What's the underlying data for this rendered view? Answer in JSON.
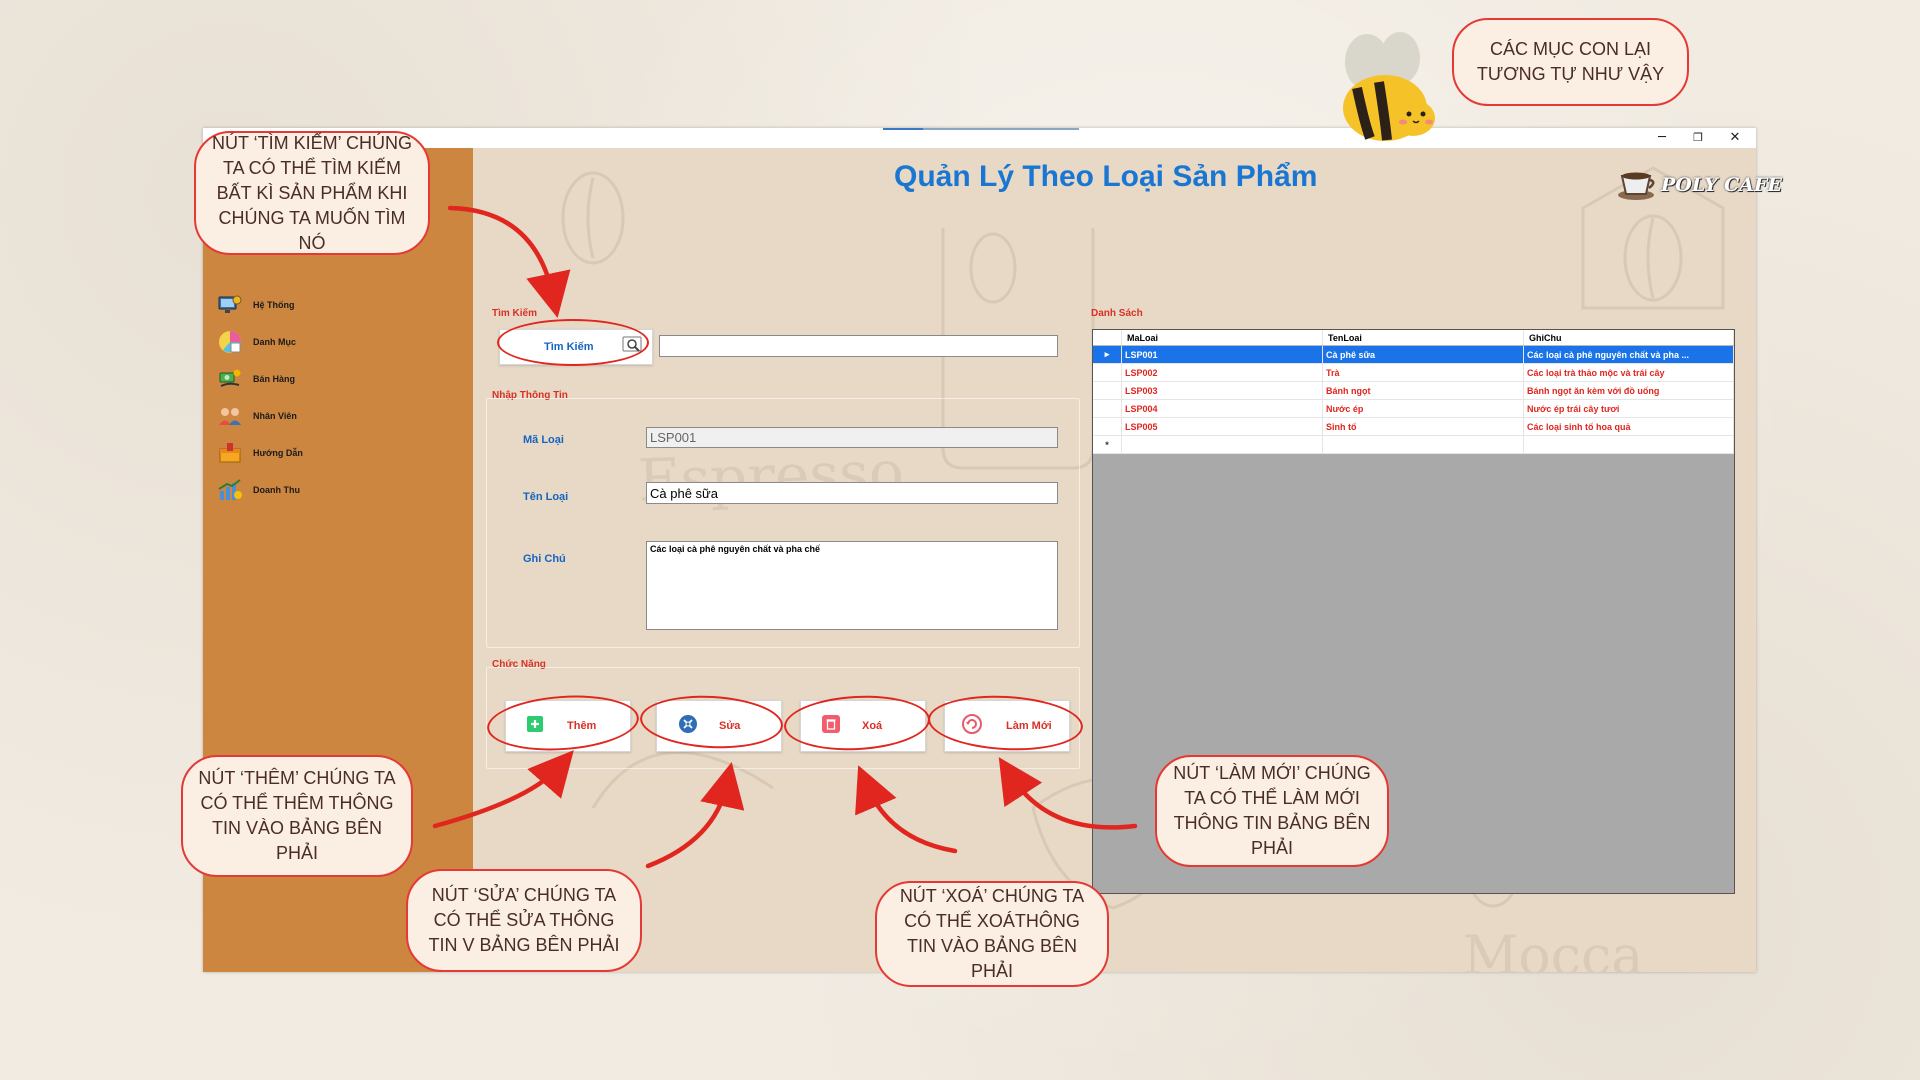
{
  "window": {
    "minimize_glyph": "─",
    "restore_glyph": "❐",
    "close_glyph": "✕"
  },
  "sidebar": {
    "items": [
      {
        "label": "Hệ Thống",
        "icon": "system-icon"
      },
      {
        "label": "Danh Mục",
        "icon": "category-icon"
      },
      {
        "label": "Bán Hàng",
        "icon": "sales-icon"
      },
      {
        "label": "Nhân Viên",
        "icon": "employee-icon"
      },
      {
        "label": "Hướng Dẫn",
        "icon": "guide-icon"
      },
      {
        "label": "Doanh Thu",
        "icon": "revenue-icon"
      }
    ]
  },
  "header": {
    "title": "Quản Lý Theo Loại Sản Phẩm",
    "logo_text": "POLY CAFE"
  },
  "search": {
    "group_title": "Tìm Kiếm",
    "button_label": "Tìm Kiếm",
    "value": ""
  },
  "form": {
    "group_title": "Nhập Thông Tin",
    "ma_loai_label": "Mã Loại",
    "ma_loai_value": "LSP001",
    "ten_loai_label": "Tên Loại",
    "ten_loai_value": "Cà phê sữa",
    "ghi_chu_label": "Ghi Chú",
    "ghi_chu_value": "Các loại cà phê nguyên chất và pha chế"
  },
  "actions": {
    "group_title": "Chức Năng",
    "add_label": "Thêm",
    "edit_label": "Sửa",
    "delete_label": "Xoá",
    "refresh_label": "Làm Mới"
  },
  "list": {
    "group_title": "Danh Sách",
    "columns": [
      "MaLoai",
      "TenLoai",
      "GhiChu"
    ],
    "rows": [
      [
        "LSP001",
        "Cà phê sữa",
        "Các loại cà phê nguyên chất và pha ..."
      ],
      [
        "LSP002",
        "Trà",
        "Các loại trà thảo mộc và trái cây"
      ],
      [
        "LSP003",
        "Bánh ngọt",
        "Bánh ngọt ăn kèm với đồ uống"
      ],
      [
        "LSP004",
        "Nước ép",
        "Nước ép trái cây tươi"
      ],
      [
        "LSP005",
        "Sinh tố",
        "Các loại sinh tố hoa quả"
      ]
    ],
    "selected_row_marker": "▸",
    "new_row_marker": "*"
  },
  "watermarks": {
    "espresso": "Espresso",
    "mocca": "Mocca"
  },
  "annotations": {
    "search_note": "NÚT ‘TÌM KIẾM’ CHÚNG TA CÓ THỂ TÌM KIẾM BẤT KÌ SẢN PHẨM KHI CHÚNG TA MUỐN TÌM NÓ",
    "add_note": "NÚT ‘THÊM’ CHÚNG TA CÓ THỂ THÊM THÔNG TIN VÀO BẢNG BÊN PHẢI",
    "edit_note": "NÚT ‘SỬA’ CHÚNG TA CÓ THỂ SỬA THÔNG TIN V BẢNG BÊN PHẢI",
    "delete_note": "NÚT ‘XOÁ’ CHÚNG TA CÓ THỂ XOÁTHÔNG TIN VÀO BẢNG BÊN PHẢI",
    "refresh_note": "NÚT ‘LÀM MỚI’ CHÚNG TA CÓ THỂ LÀM MỚI THÔNG TIN BẢNG BÊN PHẢI",
    "other_note": "CÁC MỤC CON LẠI TƯƠNG TỰ NHƯ VẬY"
  },
  "colors": {
    "sidebar": "#cd8640",
    "title": "#1976d2",
    "annotation_red": "#e53935",
    "selected_row": "#1a73e8",
    "grid_text": "#e0261e"
  }
}
